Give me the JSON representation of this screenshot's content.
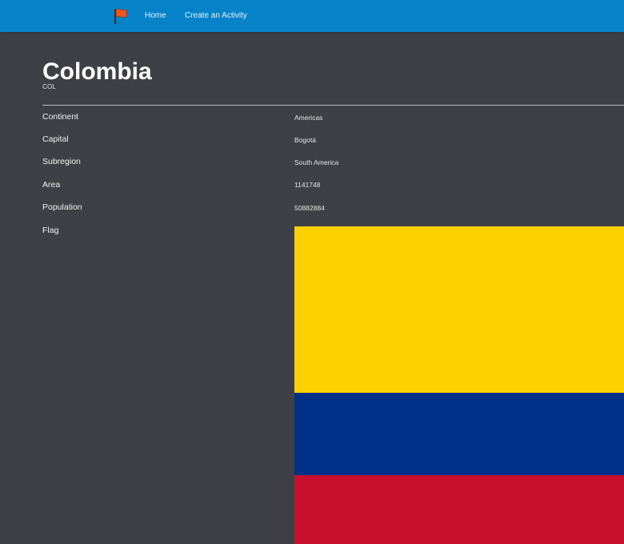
{
  "nav": {
    "home_label": "Home",
    "create_label": "Create an Activity"
  },
  "country": {
    "name": "Colombia",
    "code": "COL"
  },
  "details": {
    "continent_label": "Continent",
    "continent_value": "Americas",
    "capital_label": "Capital",
    "capital_value": "Bogotá",
    "subregion_label": "Subregion",
    "subregion_value": "South America",
    "area_label": "Area",
    "area_value": "1141748",
    "population_label": "Population",
    "population_value": "50882884",
    "flag_label": "Flag"
  },
  "flag_colors": {
    "yellow": "#fdd100",
    "blue": "#003087",
    "red": "#c8102e"
  },
  "theme": {
    "navbar": "#0683c8",
    "background": "#3f4045",
    "brand_icon": "#f0531f"
  }
}
